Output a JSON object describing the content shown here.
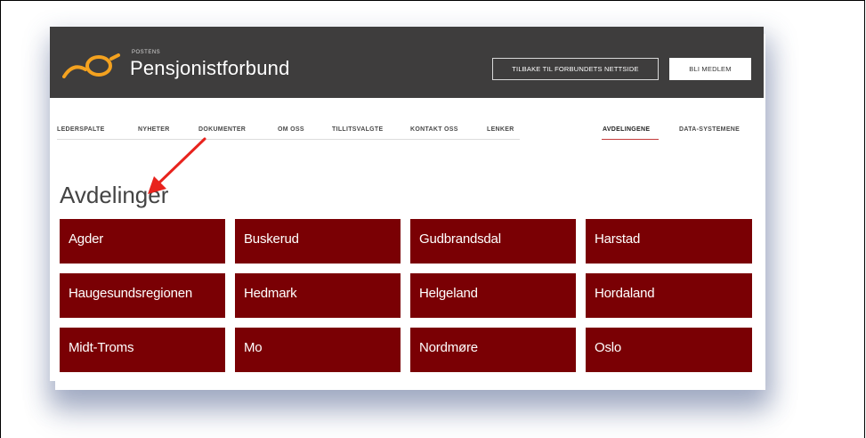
{
  "brand": {
    "small": "POSTENS",
    "name": "Pensjonistforbund"
  },
  "header": {
    "back_button": "TILBAKE TIL FORBUNDETS NETTSIDE",
    "member_button": "BLI MEDLEM"
  },
  "nav": {
    "items": [
      "LEDERSPALTE",
      "NYHETER",
      "DOKUMENTER",
      "OM OSS",
      "TILLITSVALGTE",
      "KONTAKT OSS",
      "LENKER"
    ],
    "right_items": [
      "AVDELINGENE",
      "DATA-SYSTEMENE"
    ],
    "active": "AVDELINGENE"
  },
  "page_title": "Avdelinger",
  "departments": [
    "Agder",
    "Buskerud",
    "Gudbrandsdal",
    "Harstad",
    "Haugesundsregionen",
    "Hedmark",
    "Helgeland",
    "Hordaland",
    "Midt-Troms",
    "Mo",
    "Nordmøre",
    "Oslo"
  ],
  "colors": {
    "header_bg": "#3e3d3d",
    "tile_bg": "#7a0004",
    "accent": "#c23b3b",
    "logo": "#f4a21f",
    "arrow": "#e8231d"
  },
  "icons": {
    "logo": "post-horn-icon",
    "annotation": "red-arrow-icon"
  }
}
